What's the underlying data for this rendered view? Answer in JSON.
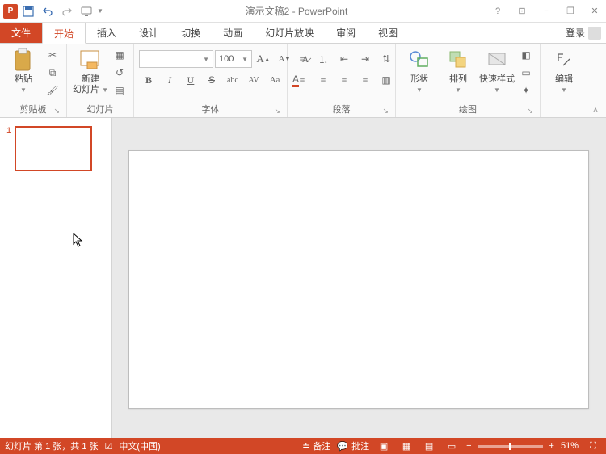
{
  "title": "演示文稿2 - PowerPoint",
  "qat": {
    "save": "save",
    "undo": "undo",
    "redo": "redo",
    "start": "start"
  },
  "win": {
    "help": "?",
    "opts": "⊡",
    "min": "−",
    "restore": "❐",
    "close": "✕"
  },
  "tabs": {
    "file": "文件",
    "home": "开始",
    "insert": "插入",
    "design": "设计",
    "transitions": "切换",
    "animations": "动画",
    "slideshow": "幻灯片放映",
    "review": "审阅",
    "view": "视图",
    "login": "登录"
  },
  "ribbon": {
    "clipboard": {
      "paste": "粘贴",
      "label": "剪贴板"
    },
    "slides": {
      "new": "新建\n幻灯片",
      "label": "幻灯片"
    },
    "font": {
      "size": "100",
      "label": "字体"
    },
    "paragraph": {
      "label": "段落"
    },
    "drawing": {
      "shapes": "形状",
      "arrange": "排列",
      "quick": "快速样式",
      "label": "绘图"
    },
    "editing": {
      "edit": "编辑"
    }
  },
  "thumb": {
    "num": "1"
  },
  "status": {
    "slide_info": "幻灯片 第 1 张，共 1 张",
    "lang": "中文(中国)",
    "notes": "备注",
    "comments": "批注",
    "zoom": "51%"
  }
}
